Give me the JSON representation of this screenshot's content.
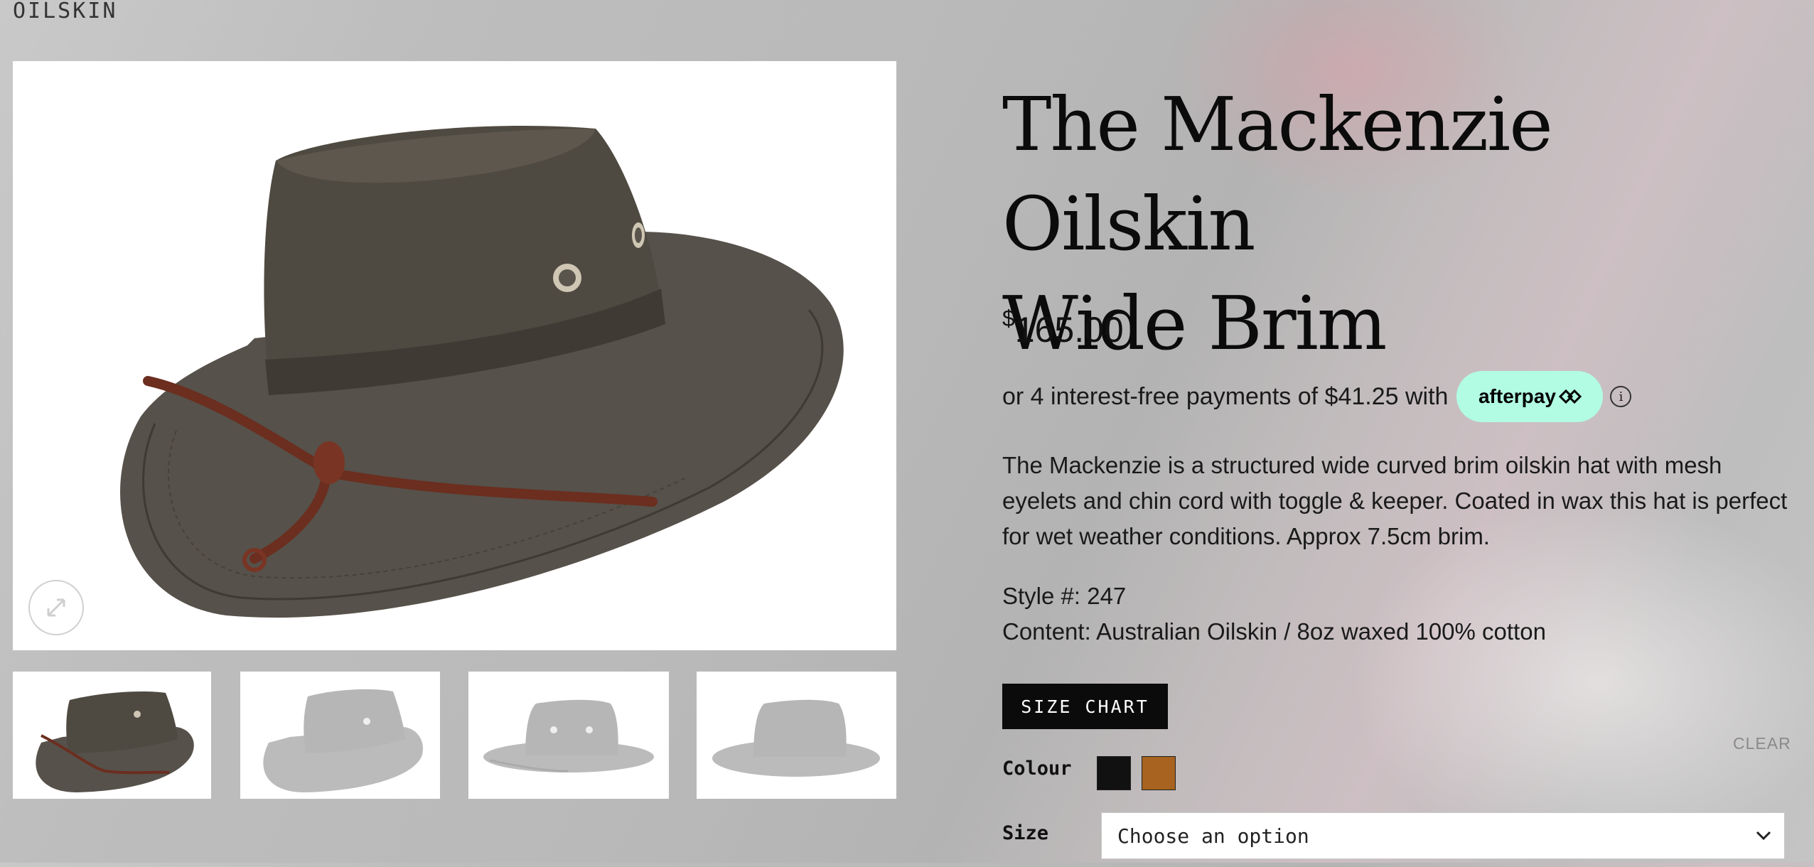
{
  "brand": "OILSKIN",
  "product": {
    "title_line1": "The Mackenzie Oilskin",
    "title_line2": "Wide Brim",
    "price_symbol": "$",
    "price_value": "165.00",
    "afterpay_text": "or 4 interest-free payments of $41.25 with",
    "afterpay_brand": "afterpay",
    "description": "The Mackenzie is a structured wide curved brim oilskin hat with mesh eyelets and chin cord with toggle & keeper. Coated in wax this hat is perfect for wet weather conditions. Approx 7.5cm brim.",
    "style": "Style #: 247",
    "content": "Content: Australian Oilskin / 8oz waxed 100% cotton"
  },
  "actions": {
    "size_chart_label": "SIZE CHART",
    "clear_label": "CLEAR"
  },
  "options": {
    "colour_label": "Colour",
    "size_label": "Size",
    "size_placeholder": "Choose an option",
    "swatches": [
      {
        "name": "black",
        "color": "#111111"
      },
      {
        "name": "tan",
        "color": "#a7631f"
      }
    ]
  },
  "colors": {
    "afterpay_mint": "#b2fce4",
    "button_black": "#0b0b0b",
    "hat_brown": "#4f4a41",
    "cord_brown": "#6b2e1f"
  }
}
